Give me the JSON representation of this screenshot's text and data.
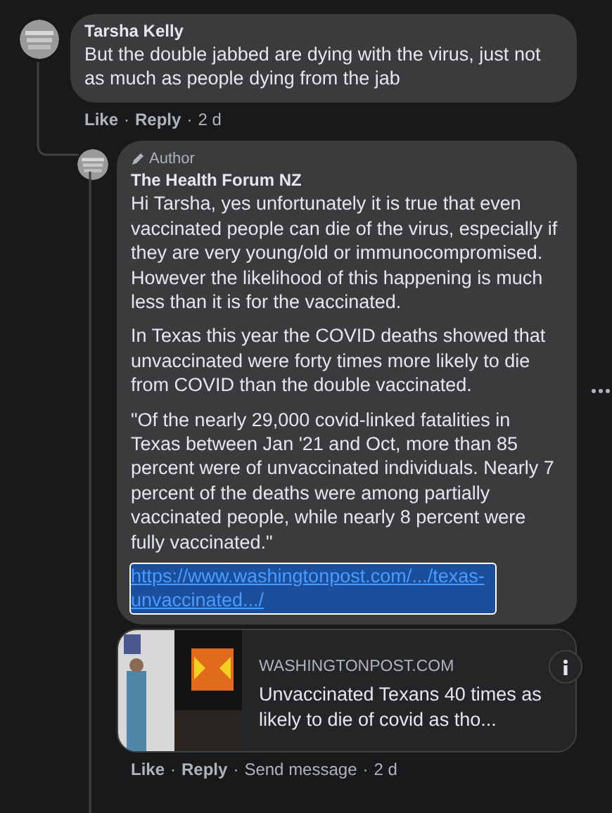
{
  "separator": "·",
  "comments": [
    {
      "author": "Tarsha Kelly",
      "paragraphs": [
        "But the double jabbed are dying with the virus, just not as much as people dying from the jab"
      ],
      "actions": [
        "Like",
        "Reply"
      ],
      "time": "2 d"
    },
    {
      "author": "The Health Forum NZ",
      "badge": "Author",
      "paragraphs": [
        "Hi Tarsha, yes unfortunately it is true that even vaccinated people can die of the virus, especially if they are very young/old or immunocompromised.\nHowever the likelihood of this happening is much less than it is for the vaccinated.",
        "In Texas this year the COVID deaths showed that unvaccinated were forty times more likely to die from COVID than the double vaccinated.",
        "\"Of the nearly 29,000 covid-linked fatalities in Texas between Jan '21 and Oct, more than 85 percent were of unvaccinated individuals. Nearly 7 percent of the deaths were among partially vaccinated people, while nearly 8 percent were fully vaccinated.\""
      ],
      "link": {
        "text": "https://www.washingtonpost.com/.../texas-unvaccinated.../",
        "selected": true
      },
      "preview": {
        "kind": "picture",
        "source": "WASHINGTONPOST.COM",
        "title": "Unvaccinated Texans 40 times as likely to die of covid as tho..."
      },
      "actions": [
        "Like",
        "Reply",
        "Send message"
      ],
      "time": "2 d"
    }
  ]
}
